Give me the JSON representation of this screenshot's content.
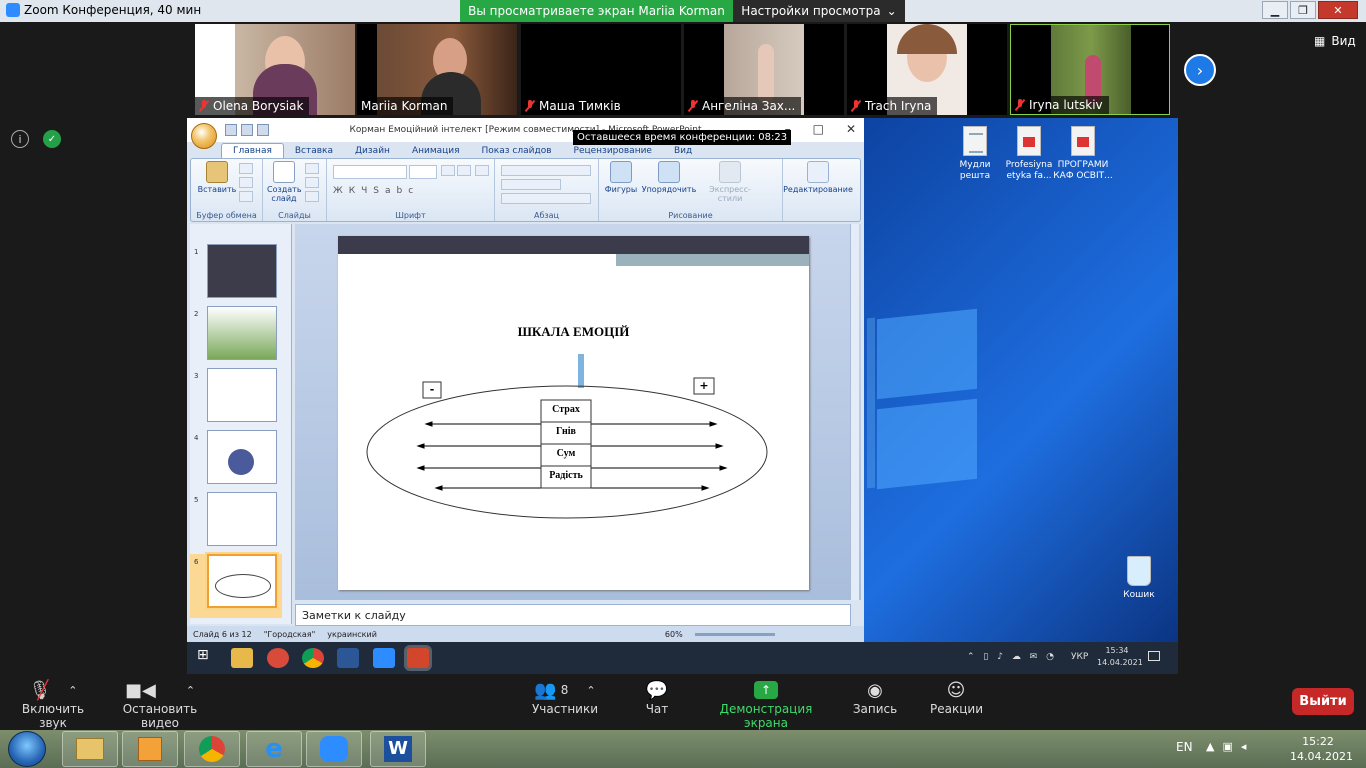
{
  "window": {
    "title": "Zoom Конференция, 40 мин",
    "minimize": "▁",
    "maximize": "❐",
    "close": "✕"
  },
  "share_banner": {
    "text": "Вы просматриваете экран Mariia Korman"
  },
  "view_settings": {
    "label": "Настройки просмотра",
    "icon": "chevron-down-icon"
  },
  "view_button": {
    "label": "Вид"
  },
  "participants_strip": [
    {
      "name": "Olena Borysiak",
      "muted": true
    },
    {
      "name": "Mariia Korman",
      "muted": false
    },
    {
      "name": "Маша Тимків",
      "muted": true
    },
    {
      "name": "Ангеліна Зах...",
      "muted": true
    },
    {
      "name": "Trach Iryna",
      "muted": true
    },
    {
      "name": "Iryna lutskiv",
      "muted": true,
      "active_speaker": true
    }
  ],
  "powerpoint": {
    "title": "Корман Емоційний інтелект [Режим совместимости] - Microsoft PowerPoint",
    "remaining_time": "Оставшееся время конференции: 08:23",
    "tabs": [
      "Главная",
      "Вставка",
      "Дизайн",
      "Анимация",
      "Показ слайдов",
      "Рецензирование",
      "Вид"
    ],
    "active_tab": "Главная",
    "groups": {
      "clipboard": {
        "label": "Буфер обмена",
        "paste": "Вставить"
      },
      "slides": {
        "label": "Слайды",
        "new_slide_line1": "Создать",
        "new_slide_line2": "слайд"
      },
      "font": {
        "label": "Шрифт"
      },
      "paragraph": {
        "label": "Абзац"
      },
      "drawing": {
        "label": "Рисование",
        "shapes": "Фигуры",
        "arrange": "Упорядочить",
        "styles": "Экспресс-стили"
      },
      "editing": {
        "label": "Редактирование"
      }
    },
    "slide": {
      "title": "ШКАЛА ЕМОЦІЙ",
      "minus": "-",
      "plus": "+",
      "emotions": [
        "Страх",
        "Гнів",
        "Сум",
        "Радість"
      ]
    },
    "notes_placeholder": "Заметки к слайду",
    "status": {
      "slide": "Слайд 6 из 12",
      "theme": "\"Городская\"",
      "language": "украинский",
      "zoom": "60%"
    }
  },
  "desktop_icons": [
    {
      "label": "Мудли решта"
    },
    {
      "label": "Profesiyna etyka fa..."
    },
    {
      "label": "ПРОГРАМИ КАФ ОСВІТ..."
    },
    {
      "label": "Кошик"
    }
  ],
  "inner_taskbar": {
    "language": "УКР",
    "time": "15:34",
    "date": "14.04.2021"
  },
  "controls": {
    "mute": "Включить звук",
    "video": "Остановить видео",
    "participants": "Участники",
    "participants_count": "8",
    "chat": "Чат",
    "share": "Демонстрация экрана",
    "record": "Запись",
    "reactions": "Реакции",
    "leave": "Выйти"
  },
  "win7_taskbar": {
    "language": "EN",
    "time": "15:22",
    "date": "14.04.2021"
  },
  "colors": {
    "share_green": "#27a844",
    "leave_red": "#c62828",
    "zoom_blue": "#2d8cff"
  }
}
